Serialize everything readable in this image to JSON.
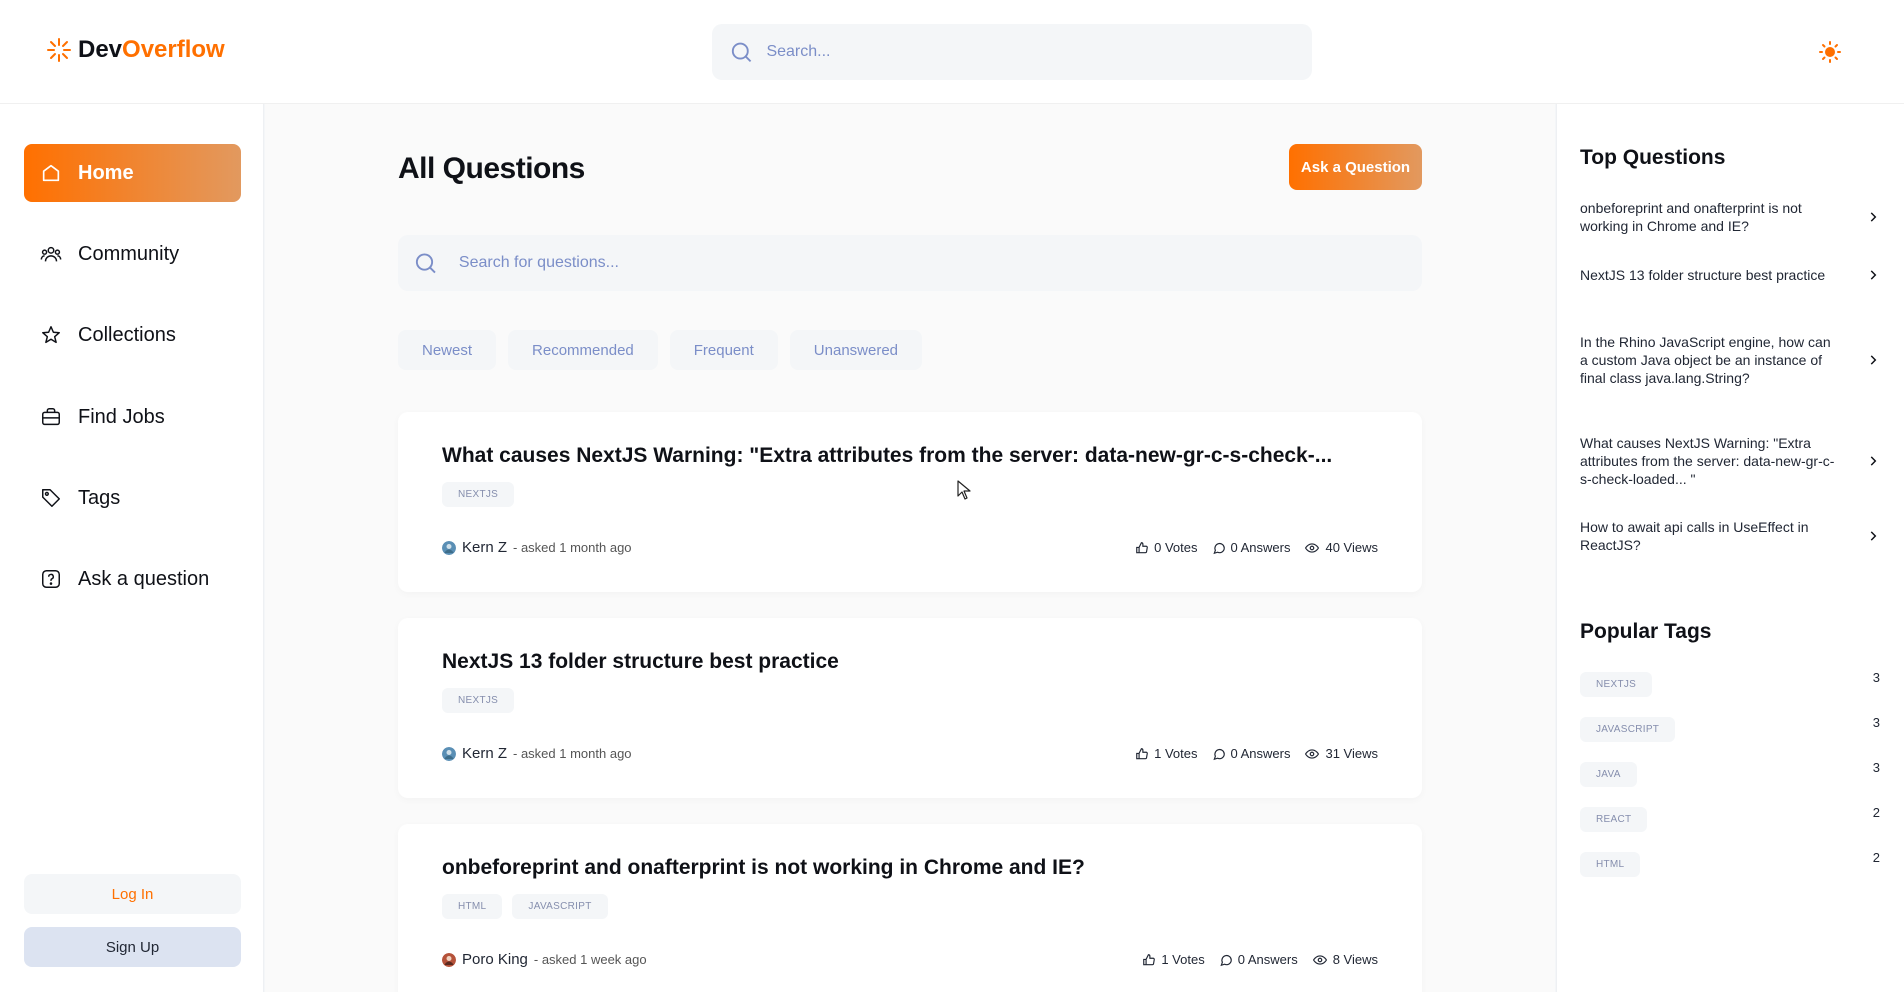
{
  "header": {
    "logo_dev": "Dev",
    "logo_overflow": "Overflow",
    "search_placeholder": "Search..."
  },
  "sidebar": {
    "items": [
      {
        "label": "Home",
        "icon": "home-icon",
        "active": true
      },
      {
        "label": "Community",
        "icon": "users-icon"
      },
      {
        "label": "Collections",
        "icon": "star-icon"
      },
      {
        "label": "Find Jobs",
        "icon": "briefcase-icon"
      },
      {
        "label": "Tags",
        "icon": "tag-icon"
      },
      {
        "label": "Ask a question",
        "icon": "question-icon"
      }
    ],
    "login_label": "Log In",
    "signup_label": "Sign Up"
  },
  "main": {
    "title": "All Questions",
    "ask_button": "Ask a Question",
    "search_placeholder": "Search for questions...",
    "filters": [
      "Newest",
      "Recommended",
      "Frequent",
      "Unanswered"
    ],
    "questions": [
      {
        "title": "What causes NextJS Warning: \"Extra attributes from the server: data-new-gr-c-s-check-...",
        "tags": [
          "NEXTJS"
        ],
        "author": "Kern Z",
        "asked": "- asked 1 month ago",
        "votes": "0 Votes",
        "answers": "0 Answers",
        "views": "40 Views"
      },
      {
        "title": "NextJS 13 folder structure best practice",
        "tags": [
          "NEXTJS"
        ],
        "author": "Kern Z",
        "asked": "- asked 1 month ago",
        "votes": "1 Votes",
        "answers": "0 Answers",
        "views": "31 Views"
      },
      {
        "title": "onbeforeprint and onafterprint is not working in Chrome and IE?",
        "tags": [
          "HTML",
          "JAVASCRIPT"
        ],
        "author": "Poro King",
        "asked": "- asked 1 week ago",
        "votes": "1 Votes",
        "answers": "0 Answers",
        "views": "8 Views"
      }
    ]
  },
  "right_sidebar": {
    "top_questions_title": "Top Questions",
    "top_questions": [
      "onbeforeprint and onafterprint is not working in Chrome and IE?",
      "NextJS 13 folder structure best practice",
      "In the Rhino JavaScript engine, how can a custom Java object be an instance of final class java.lang.String?",
      "What causes NextJS Warning: \"Extra attributes from the server: data-new-gr-c-s-check-loaded... \"",
      "How to await api calls in UseEffect in ReactJS?"
    ],
    "popular_tags_title": "Popular Tags",
    "popular_tags": [
      {
        "name": "NEXTJS",
        "count": "3"
      },
      {
        "name": "JAVASCRIPT",
        "count": "3"
      },
      {
        "name": "JAVA",
        "count": "3"
      },
      {
        "name": "REACT",
        "count": "2"
      },
      {
        "name": "HTML",
        "count": "2"
      }
    ]
  },
  "colors": {
    "accent": "#ff7000",
    "accent_light": "#e2995f",
    "muted_text": "#7b8ec8"
  }
}
